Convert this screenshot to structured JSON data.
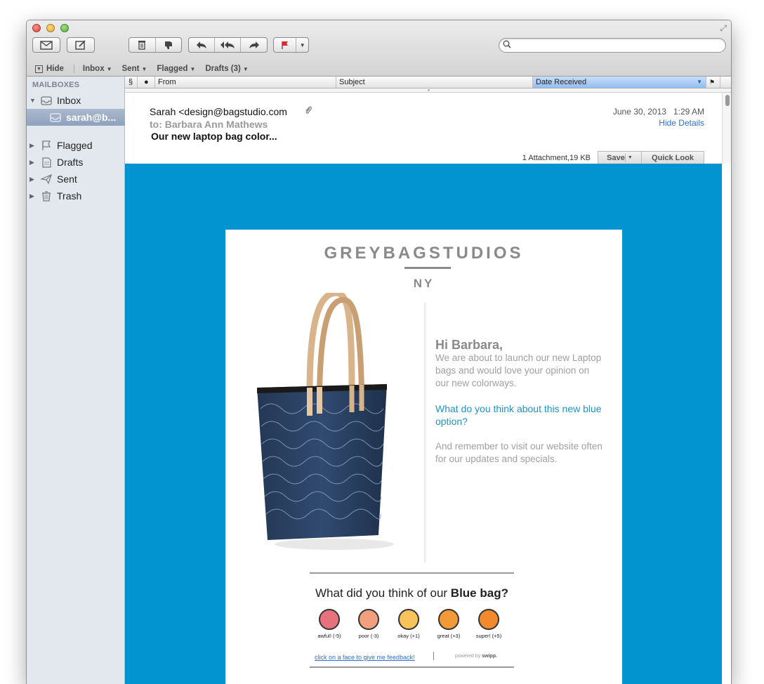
{
  "window": {
    "title": ""
  },
  "toolbar": {
    "get_mail_icon": "envelope-icon",
    "compose_icon": "compose-icon",
    "delete_icon": "trash-icon",
    "junk_icon": "thumbs-down-icon",
    "reply_icon": "reply-icon",
    "reply_all_icon": "reply-all-icon",
    "forward_icon": "forward-icon",
    "flag_icon": "flag-icon",
    "search_placeholder": ""
  },
  "favorites": {
    "hide_label": "Hide",
    "items": [
      {
        "label": "Inbox"
      },
      {
        "label": "Sent"
      },
      {
        "label": "Flagged"
      },
      {
        "label": "Drafts (3)"
      }
    ]
  },
  "sidebar": {
    "heading": "MAILBOXES",
    "inbox_label": "Inbox",
    "account_label": "sarah@b...",
    "items": [
      {
        "label": "Flagged",
        "icon": "flag-icon"
      },
      {
        "label": "Drafts",
        "icon": "draft-icon"
      },
      {
        "label": "Sent",
        "icon": "paper-plane-icon"
      },
      {
        "label": "Trash",
        "icon": "trash-icon"
      }
    ]
  },
  "columns": {
    "from": "From",
    "subject": "Subject",
    "date_received": "Date Received"
  },
  "message": {
    "from": "Sarah <design@bagstudio.com",
    "to": "to: Barbara Ann Mathews",
    "subject": "Our new laptop bag color...",
    "date": "June 30, 2013",
    "time": "1:29 AM",
    "hide_details": "Hide Details",
    "attachment_info": "1 Attachment,19 KB",
    "save_label": "Save",
    "quick_look_label": "Quick Look"
  },
  "email_body": {
    "brand": "GREYBAGSTUDIOS",
    "brand_sub": "NY",
    "greeting": "Hi Barbara,",
    "para1": "We are about to launch our new Laptop bags and would love your opinion on our new colorways.",
    "para2": "What do you think about this new blue option?",
    "para3": "And remember to visit our website often for our updates and specials.",
    "background_color": "#0194d0",
    "accent_color": "#1f93c9"
  },
  "feedback": {
    "question_prefix": "What did you think of our ",
    "question_bold": "Blue bag?",
    "faces": [
      {
        "label": "awful! (-5)",
        "color": "#e8717e"
      },
      {
        "label": "poor (-3)",
        "color": "#f0a07f"
      },
      {
        "label": "okay (+1)",
        "color": "#f7c35a"
      },
      {
        "label": "great (+3)",
        "color": "#f39a38"
      },
      {
        "label": "super! (+5)",
        "color": "#f08a2c"
      }
    ],
    "link": "click on a face to give me feedback!",
    "powered_prefix": "powered by ",
    "powered_brand": "swipp."
  }
}
